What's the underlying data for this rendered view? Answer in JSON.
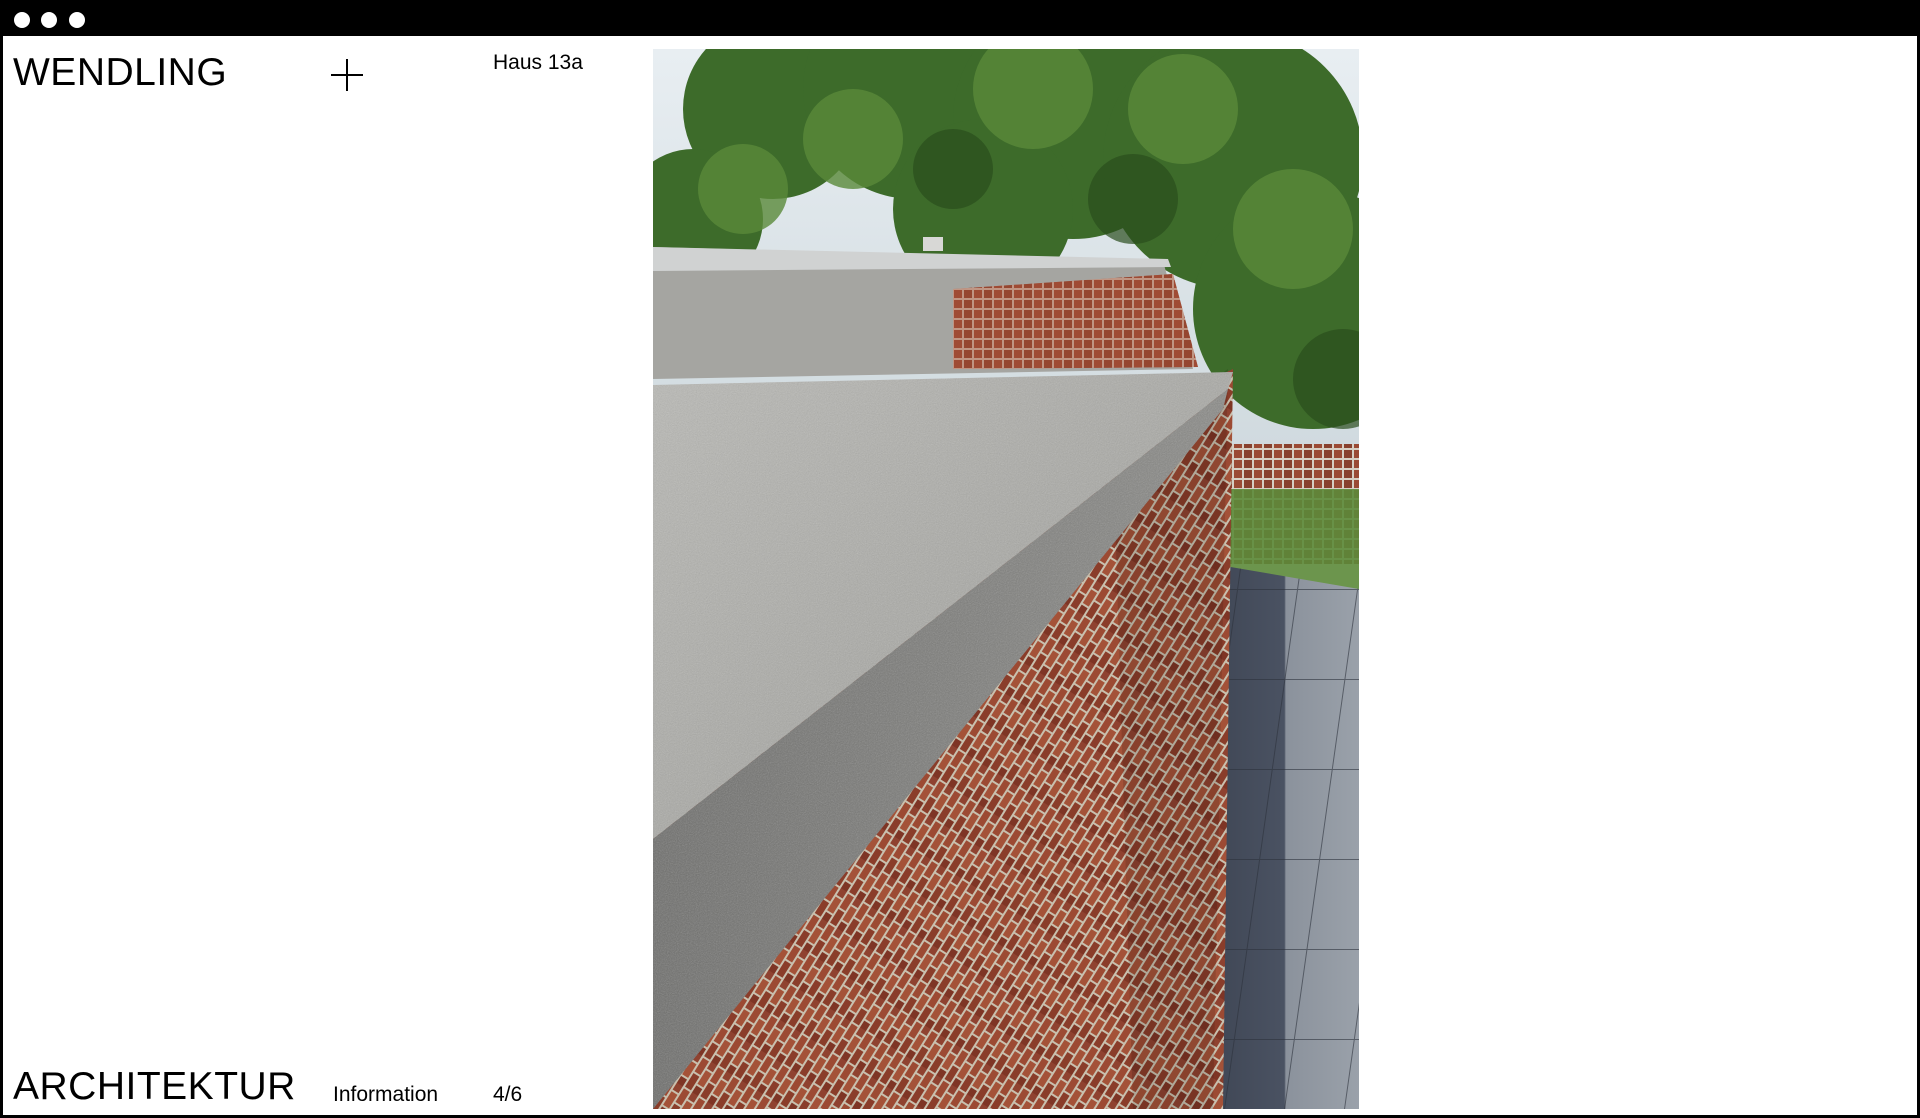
{
  "brand": {
    "top": "WENDLING",
    "bottom": "ARCHITEKTUR"
  },
  "project": {
    "title": "Haus 13a"
  },
  "nav": {
    "information_label": "Information",
    "counter": "4/6"
  },
  "icons": {
    "menu": "plus-icon"
  },
  "colors": {
    "titlebar": "#000000",
    "background": "#ffffff",
    "text": "#000000"
  }
}
